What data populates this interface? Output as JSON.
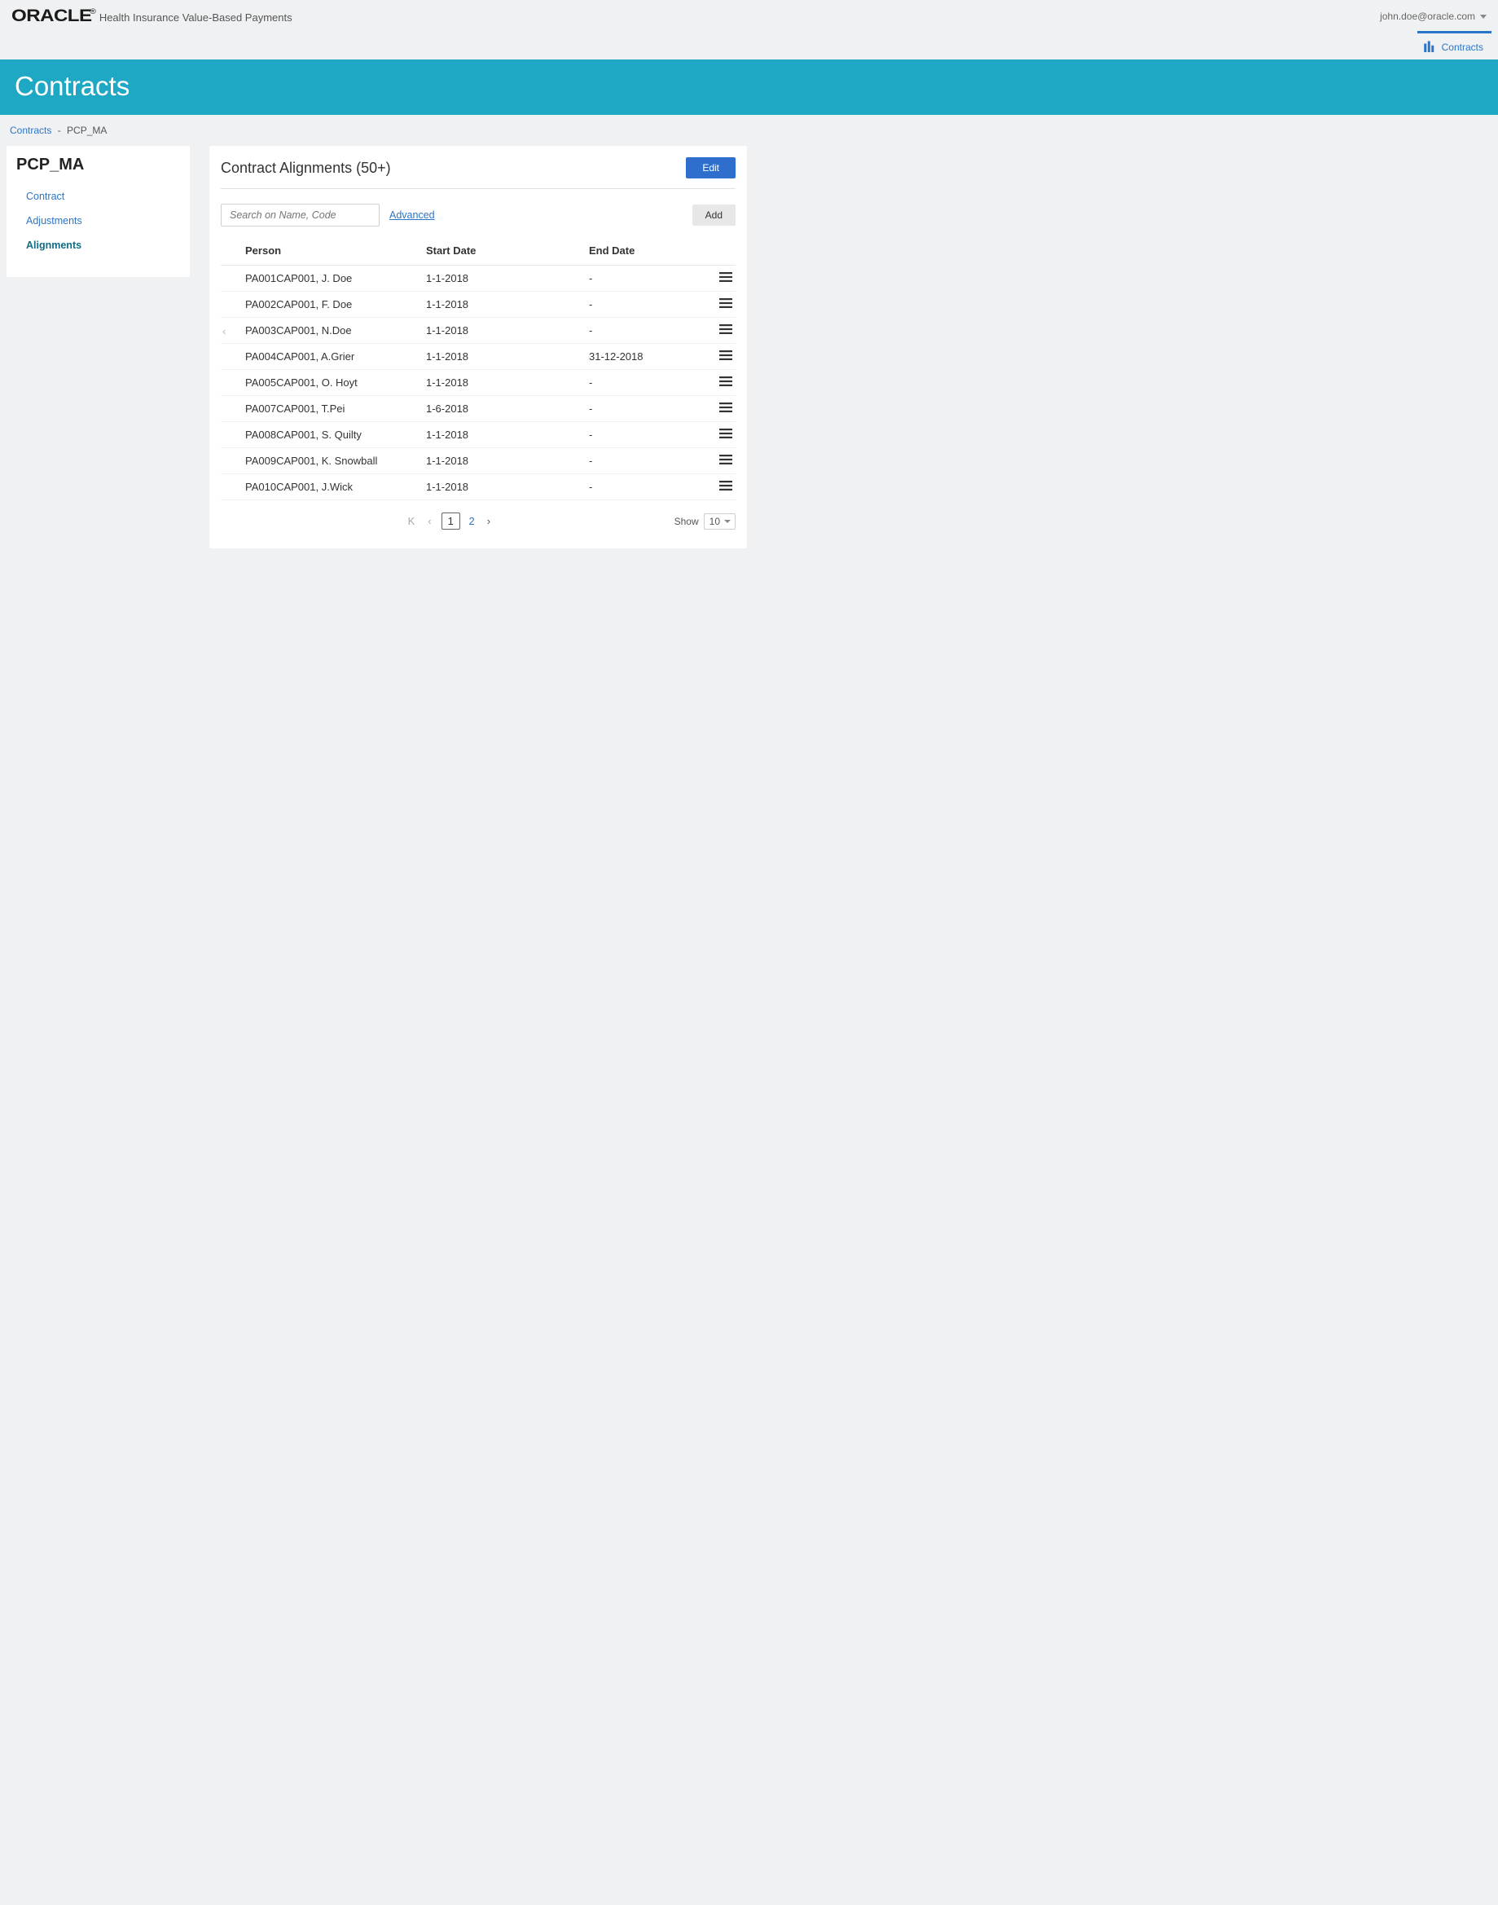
{
  "header": {
    "brand": "ORACLE",
    "brand_sup": "®",
    "subtitle": "Health Insurance Value-Based Payments",
    "user": "john.doe@oracle.com"
  },
  "nav": {
    "contracts_tab": "Contracts"
  },
  "banner": {
    "title": "Contracts"
  },
  "breadcrumb": {
    "root": "Contracts",
    "sep": "-",
    "current": "PCP_MA"
  },
  "sidebar": {
    "title": "PCP_MA",
    "items": [
      {
        "label": "Contract",
        "active": false
      },
      {
        "label": "Adjustments",
        "active": false
      },
      {
        "label": "Alignments",
        "active": true
      }
    ]
  },
  "card": {
    "title": "Contract Alignments (50+)",
    "edit_label": "Edit",
    "add_label": "Add",
    "search_placeholder": "Search on Name, Code",
    "advanced_label": "Advanced"
  },
  "table": {
    "columns": {
      "person": "Person",
      "start": "Start Date",
      "end": "End Date"
    },
    "rows": [
      {
        "person": "PA001CAP001, J. Doe",
        "start": "1-1-2018",
        "end": "-"
      },
      {
        "person": "PA002CAP001, F. Doe",
        "start": "1-1-2018",
        "end": "-"
      },
      {
        "person": "PA003CAP001, N.Doe",
        "start": "1-1-2018",
        "end": "-"
      },
      {
        "person": "PA004CAP001, A.Grier",
        "start": "1-1-2018",
        "end": "31-12-2018"
      },
      {
        "person": "PA005CAP001, O. Hoyt",
        "start": "1-1-2018",
        "end": "-"
      },
      {
        "person": "PA007CAP001, T.Pei",
        "start": "1-6-2018",
        "end": "-"
      },
      {
        "person": "PA008CAP001, S. Quilty",
        "start": "1-1-2018",
        "end": "-"
      },
      {
        "person": "PA009CAP001, K. Snowball",
        "start": "1-1-2018",
        "end": "-"
      },
      {
        "person": "PA010CAP001, J.Wick",
        "start": "1-1-2018",
        "end": "-"
      }
    ]
  },
  "pagination": {
    "first": "K",
    "prev": "‹",
    "pages": [
      "1",
      "2"
    ],
    "current": "1",
    "next": "›",
    "show_label": "Show",
    "show_value": "10"
  }
}
